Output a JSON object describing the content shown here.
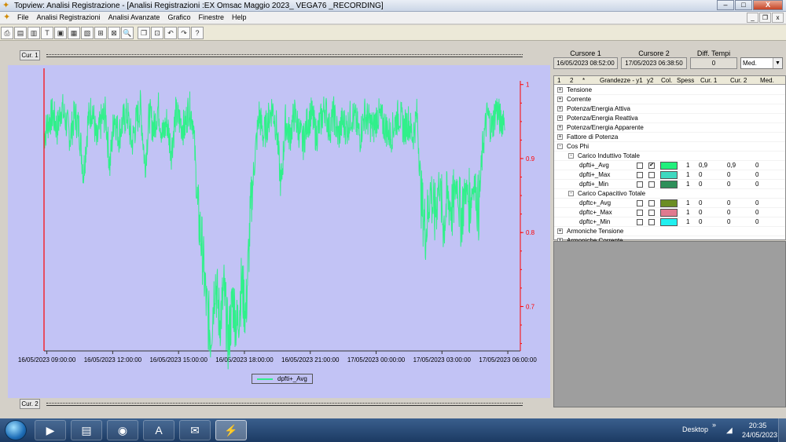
{
  "window": {
    "title": "Topview: Analisi Registrazione - [Analisi Registrazioni :EX Omsac Maggio 2023_ VEGA76 _RECORDING]",
    "controls": {
      "minimize": "–",
      "maximize": "□",
      "close": "X"
    }
  },
  "menu": {
    "items": [
      "File",
      "Analisi Registrazioni",
      "Analisi Avanzate",
      "Grafico",
      "Finestre",
      "Help"
    ],
    "mdi": {
      "minimize": "_",
      "restore": "❐",
      "close": "x"
    }
  },
  "toolbar": {
    "glyphs": [
      "⎙",
      "▤",
      "▥",
      "T",
      "▣",
      "▦",
      "▧",
      "⊞",
      "⊠",
      "🔍",
      "❐",
      "⊡",
      "↶",
      "↷",
      "?"
    ]
  },
  "cursor_bars": {
    "cur1_label": "Cur. 1",
    "cur2_label": "Cur. 2"
  },
  "cursors": {
    "cursore1_label": "Cursore 1",
    "cursore2_label": "Cursore 2",
    "diff_label": "Diff. Tempi",
    "cursore1_value": "16/05/2023 08:52:00",
    "cursore2_value": "17/05/2023 06:38:50",
    "diff_value": "0",
    "mode_value": "Med."
  },
  "grid": {
    "headers": [
      "1",
      "2",
      "*",
      "Grandezze - y1",
      "y2",
      "Col.",
      "Spess",
      "Cur. 1",
      "Cur. 2",
      "Med."
    ],
    "rows": [
      {
        "level": 0,
        "exp": "+",
        "label": "Tensione"
      },
      {
        "level": 0,
        "exp": "+",
        "label": "Corrente"
      },
      {
        "level": 0,
        "exp": "+",
        "label": "Potenza/Energia Attiva"
      },
      {
        "level": 0,
        "exp": "+",
        "label": "Potenza/Energia Reattiva"
      },
      {
        "level": 0,
        "exp": "+",
        "label": "Potenza/Energia Apparente"
      },
      {
        "level": 0,
        "exp": "+",
        "label": "Fattore di Potenza"
      },
      {
        "level": 0,
        "exp": "-",
        "label": "Cos Phi"
      },
      {
        "level": 1,
        "exp": "-",
        "label": "Carico Induttivo Totale"
      },
      {
        "level": 2,
        "label": "dpfti+_Avg",
        "y1": "",
        "y2": "✔",
        "color": "#20f07c",
        "spess": "1",
        "cur1": "0,9",
        "cur2": "0,9",
        "med": "0"
      },
      {
        "level": 2,
        "label": "dpfti+_Max",
        "y1": "",
        "y2": "",
        "color": "#3fd9c0",
        "spess": "1",
        "cur1": "0",
        "cur2": "0",
        "med": "0"
      },
      {
        "level": 2,
        "label": "dpfti+_Min",
        "y1": "",
        "y2": "",
        "color": "#2f8f5a",
        "spess": "1",
        "cur1": "0",
        "cur2": "0",
        "med": "0"
      },
      {
        "level": 1,
        "exp": "-",
        "label": "Carico Capacitivo Totale"
      },
      {
        "level": 2,
        "label": "dpftc+_Avg",
        "y1": "",
        "y2": "",
        "color": "#6b8e23",
        "spess": "1",
        "cur1": "0",
        "cur2": "0",
        "med": "0"
      },
      {
        "level": 2,
        "label": "dpftc+_Max",
        "y1": "",
        "y2": "",
        "color": "#e07a8f",
        "spess": "1",
        "cur1": "0",
        "cur2": "0",
        "med": "0"
      },
      {
        "level": 2,
        "label": "dpftc+_Min",
        "y1": "",
        "y2": "",
        "color": "#20f0f0",
        "spess": "1",
        "cur1": "0",
        "cur2": "0",
        "med": "0"
      },
      {
        "level": 0,
        "exp": "+",
        "label": "Armoniche Tensione"
      },
      {
        "level": 0,
        "exp": "+",
        "label": "Armoniche Corrente"
      }
    ]
  },
  "chart_data": {
    "type": "line",
    "series": [
      {
        "name": "dpfti+_Avg",
        "color": "#30f08a",
        "points": [
          [
            0.0,
            0.93
          ],
          [
            0.2,
            0.95
          ],
          [
            0.4,
            0.96
          ],
          [
            0.6,
            0.94
          ],
          [
            0.8,
            0.97
          ],
          [
            1.0,
            0.95
          ],
          [
            1.2,
            0.93
          ],
          [
            1.4,
            0.96
          ],
          [
            1.6,
            0.94
          ],
          [
            1.8,
            0.88
          ],
          [
            2.0,
            0.95
          ],
          [
            2.2,
            0.97
          ],
          [
            2.4,
            0.92
          ],
          [
            2.6,
            0.95
          ],
          [
            2.8,
            0.96
          ],
          [
            3.0,
            0.89
          ],
          [
            3.2,
            0.96
          ],
          [
            3.4,
            0.93
          ],
          [
            3.6,
            0.95
          ],
          [
            3.8,
            0.96
          ],
          [
            4.0,
            0.92
          ],
          [
            4.2,
            0.95
          ],
          [
            4.4,
            0.97
          ],
          [
            4.6,
            0.89
          ],
          [
            4.8,
            0.96
          ],
          [
            5.0,
            0.94
          ],
          [
            5.2,
            0.97
          ],
          [
            5.4,
            0.93
          ],
          [
            5.6,
            0.95
          ],
          [
            5.8,
            0.91
          ],
          [
            6.0,
            0.96
          ],
          [
            6.2,
            0.95
          ],
          [
            6.4,
            0.94
          ],
          [
            6.6,
            0.97
          ],
          [
            6.8,
            0.95
          ],
          [
            7.0,
            0.83
          ],
          [
            7.2,
            0.78
          ],
          [
            7.4,
            0.7
          ],
          [
            7.6,
            0.66
          ],
          [
            7.8,
            0.74
          ],
          [
            8.0,
            0.68
          ],
          [
            8.2,
            0.72
          ],
          [
            8.4,
            0.65
          ],
          [
            8.6,
            0.71
          ],
          [
            8.8,
            0.67
          ],
          [
            9.0,
            0.73
          ],
          [
            9.2,
            0.69
          ],
          [
            9.4,
            0.82
          ],
          [
            9.6,
            0.9
          ],
          [
            9.8,
            0.96
          ],
          [
            10.0,
            0.93
          ],
          [
            10.2,
            0.95
          ],
          [
            10.4,
            0.97
          ],
          [
            10.6,
            0.94
          ],
          [
            10.8,
            0.86
          ],
          [
            11.0,
            0.95
          ],
          [
            11.2,
            0.93
          ],
          [
            11.4,
            0.96
          ],
          [
            11.6,
            0.94
          ],
          [
            11.8,
            0.92
          ],
          [
            12.0,
            0.95
          ],
          [
            12.2,
            0.96
          ],
          [
            12.4,
            0.93
          ],
          [
            12.6,
            0.95
          ],
          [
            12.8,
            0.97
          ],
          [
            13.0,
            0.94
          ],
          [
            13.2,
            0.96
          ],
          [
            13.4,
            0.93
          ],
          [
            13.6,
            0.95
          ],
          [
            13.8,
            0.94
          ],
          [
            14.0,
            0.96
          ],
          [
            14.2,
            0.95
          ],
          [
            14.4,
            0.93
          ],
          [
            14.6,
            0.96
          ],
          [
            14.8,
            0.95
          ],
          [
            15.0,
            0.94
          ],
          [
            15.2,
            0.96
          ],
          [
            15.4,
            0.95
          ],
          [
            15.6,
            0.94
          ],
          [
            15.8,
            0.93
          ],
          [
            16.0,
            0.95
          ],
          [
            16.2,
            0.96
          ],
          [
            16.4,
            0.94
          ],
          [
            16.6,
            0.95
          ],
          [
            16.8,
            0.93
          ],
          [
            17.0,
            0.96
          ],
          [
            17.2,
            0.84
          ],
          [
            17.4,
            0.8
          ],
          [
            17.6,
            0.86
          ],
          [
            17.8,
            0.82
          ],
          [
            18.0,
            0.87
          ],
          [
            18.2,
            0.81
          ],
          [
            18.4,
            0.85
          ],
          [
            18.6,
            0.83
          ],
          [
            18.8,
            0.87
          ],
          [
            19.0,
            0.82
          ],
          [
            19.2,
            0.86
          ],
          [
            19.4,
            0.84
          ],
          [
            19.6,
            0.87
          ],
          [
            19.8,
            0.83
          ],
          [
            20.0,
            0.92
          ],
          [
            20.2,
            0.96
          ],
          [
            20.4,
            0.94
          ],
          [
            20.6,
            0.97
          ],
          [
            20.8,
            0.95
          ],
          [
            21.0,
            0.96
          ]
        ]
      }
    ],
    "x_tick_labels": [
      "16/05/2023 09:00:00",
      "16/05/2023 12:00:00",
      "16/05/2023 15:00:00",
      "16/05/2023 18:00:00",
      "16/05/2023 21:00:00",
      "17/05/2023 00:00:00",
      "17/05/2023 03:00:00",
      "17/05/2023 06:00:00"
    ],
    "x_ticks": [
      0.13,
      3.13,
      6.13,
      9.13,
      12.13,
      15.13,
      18.13,
      21.13
    ],
    "xlim": [
      0,
      21.7
    ],
    "y_tick_labels": [
      "1",
      "0.9",
      "0.8",
      "0.7"
    ],
    "y_ticks": [
      1.0,
      0.9,
      0.8,
      0.7
    ],
    "ylim": [
      0.64,
      1.005
    ],
    "y_axis_side": "right",
    "cursor1_x": 0.0,
    "legend": [
      "dpfti+_Avg"
    ],
    "legend_position": "bottom-center",
    "grid": false,
    "background": "#c2c3f5",
    "cursor_color": "#ff0000",
    "axis_color": "#ff0000"
  },
  "taskbar": {
    "apps": [
      {
        "name": "media-player",
        "glyph": "▶"
      },
      {
        "name": "file-explorer",
        "glyph": "▤"
      },
      {
        "name": "chrome",
        "glyph": "◉"
      },
      {
        "name": "acrobat",
        "glyph": "A"
      },
      {
        "name": "outlook",
        "glyph": "✉"
      },
      {
        "name": "topview",
        "glyph": "⚡"
      }
    ],
    "desktop_label": "Desktop",
    "chevron": "»",
    "time": "20:35",
    "date": "24/05/2023"
  }
}
